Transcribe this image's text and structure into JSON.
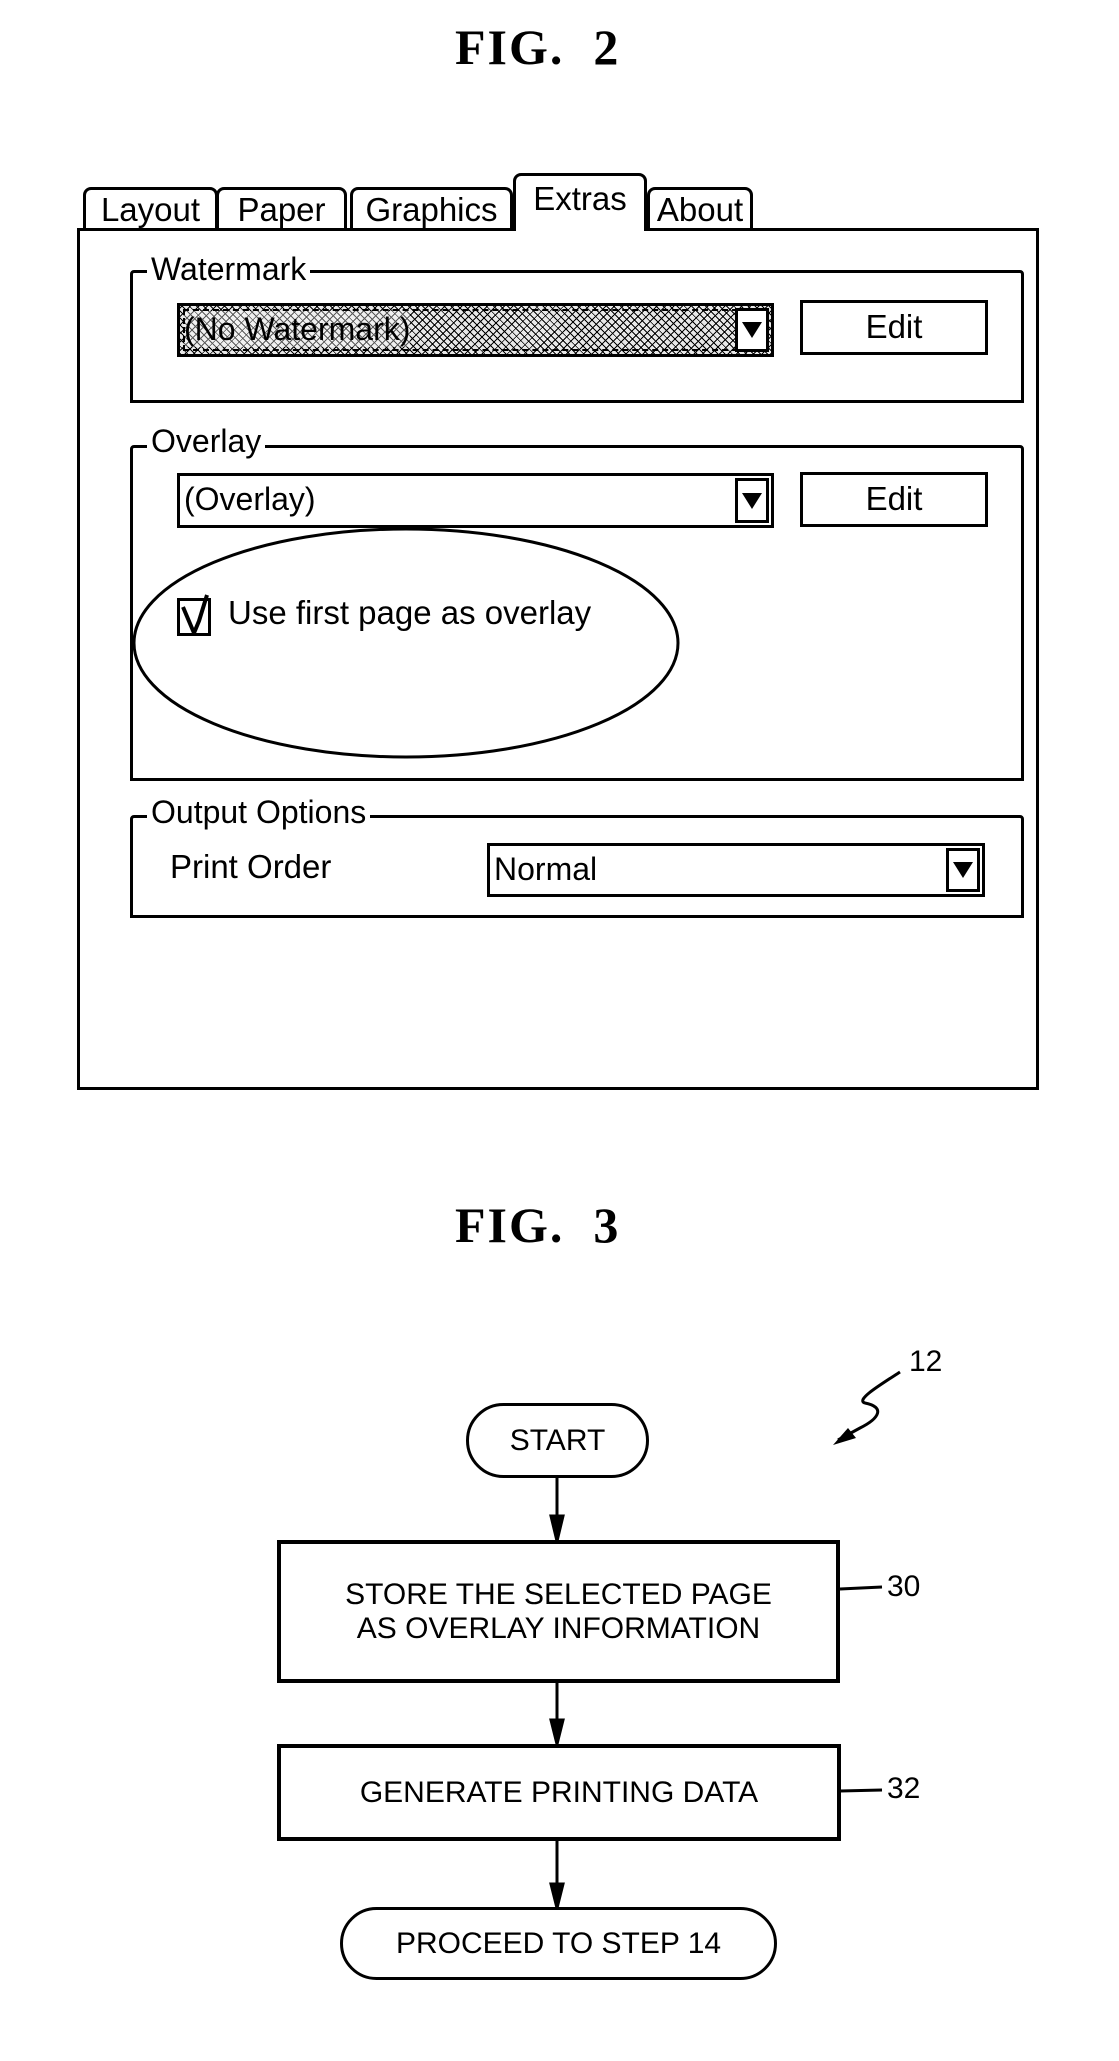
{
  "fig2": {
    "title": "FIG.  2",
    "tabs": [
      {
        "label": "Layout",
        "active": false
      },
      {
        "label": "Paper",
        "active": false
      },
      {
        "label": "Graphics",
        "active": false
      },
      {
        "label": "Extras",
        "active": true
      },
      {
        "label": "About",
        "active": false
      }
    ],
    "watermark": {
      "group_label": "Watermark",
      "selected": "(No Watermark)",
      "edit_label": "Edit"
    },
    "overlay": {
      "group_label": "Overlay",
      "selected": "(Overlay)",
      "edit_label": "Edit",
      "checkbox_label": "Use first page as overlay",
      "checkbox_checked": true
    },
    "output_options": {
      "group_label": "Output Options",
      "print_order_label": "Print Order",
      "print_order_value": "Normal"
    }
  },
  "fig3": {
    "title": "FIG.  3",
    "reference": "12",
    "nodes": [
      {
        "id": "start",
        "type": "terminal",
        "lines": [
          "START"
        ]
      },
      {
        "id": "step30",
        "type": "process",
        "lines": [
          "STORE THE SELECTED PAGE",
          "AS OVERLAY INFORMATION"
        ],
        "ref": "30"
      },
      {
        "id": "step32",
        "type": "process",
        "lines": [
          "GENERATE PRINTING DATA"
        ],
        "ref": "32"
      },
      {
        "id": "end",
        "type": "terminal",
        "lines": [
          "PROCEED TO STEP 14"
        ]
      }
    ]
  }
}
